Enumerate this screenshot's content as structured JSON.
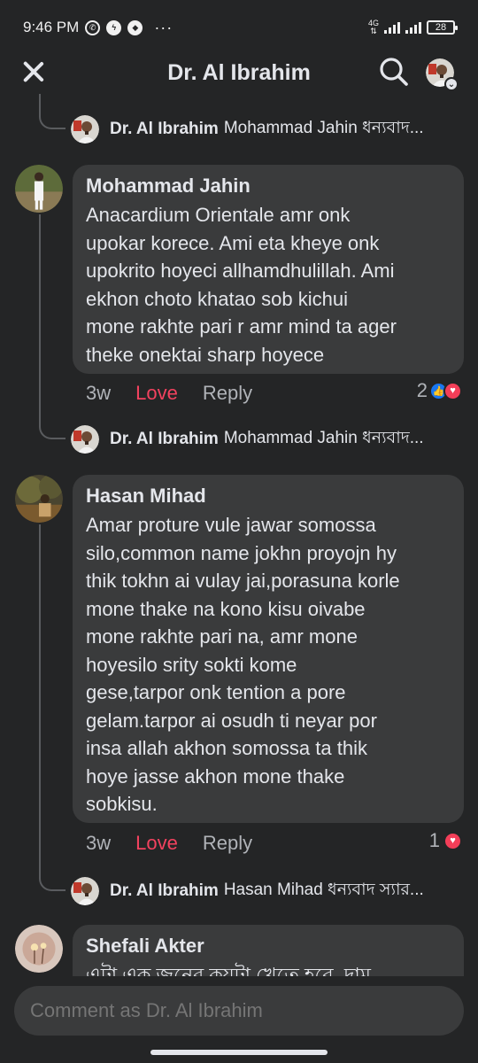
{
  "status_bar": {
    "time": "9:46 PM",
    "network": "4G",
    "battery": "28",
    "icons": [
      "whatsapp-icon",
      "messenger-icon",
      "shield-icon"
    ]
  },
  "header": {
    "title": "Dr. Al Ibrahim"
  },
  "replies": [
    {
      "name": "Dr. Al Ibrahim",
      "text": "Mohammad Jahin ধন্যবাদ..."
    },
    {
      "name": "Dr. Al Ibrahim",
      "text": "Mohammad Jahin ধন্যবাদ..."
    },
    {
      "name": "Dr. Al Ibrahim",
      "text": "Hasan Mihad ধন্যবাদ স্যার..."
    }
  ],
  "comments": [
    {
      "name": "Mohammad Jahin",
      "text": "Anacardium Orientale amr onk\nupokar korece. Ami eta kheye onk\nupokrito hoyeci allhamdhulillah. Ami\nekhon choto khatao sob kichui\nmone rakhte pari r amr mind ta ager\ntheke onektai sharp hoyece",
      "time": "3w",
      "love": "Love",
      "reply": "Reply",
      "reaction_count": "2",
      "reaction_icons": [
        "like-icon",
        "love-icon"
      ]
    },
    {
      "name": "Hasan Mihad",
      "text": "Amar proture vule jawar somossa\nsilo,common name jokhn proyojn hy\nthik tokhn ai vulay jai,porasuna korle\nmone thake na kono kisu oivabe\nmone rakhte pari na,  amr mone\nhoyesilo srity sokti kome\ngese,tarpor onk tention a pore\ngelam.tarpor ai osudh ti neyar por\ninsa allah akhon somossa ta thik\nhoye jasse akhon mone thake\nsobkisu.",
      "time": "3w",
      "love": "Love",
      "reply": "Reply",
      "reaction_count": "1",
      "reaction_icons": [
        "love-icon"
      ]
    },
    {
      "name": "Shefali Akter",
      "text": "এটা এক জনের কয়টা খেতে হবে, দাম"
    }
  ],
  "composer": {
    "placeholder": "Comment as Dr. Al Ibrahim"
  },
  "colors": {
    "background": "#242526",
    "bubble": "#3a3b3c",
    "text": "#e4e6eb",
    "muted": "#b0b3b8",
    "love": "#f3425f",
    "like_blue": "#1877f2"
  }
}
